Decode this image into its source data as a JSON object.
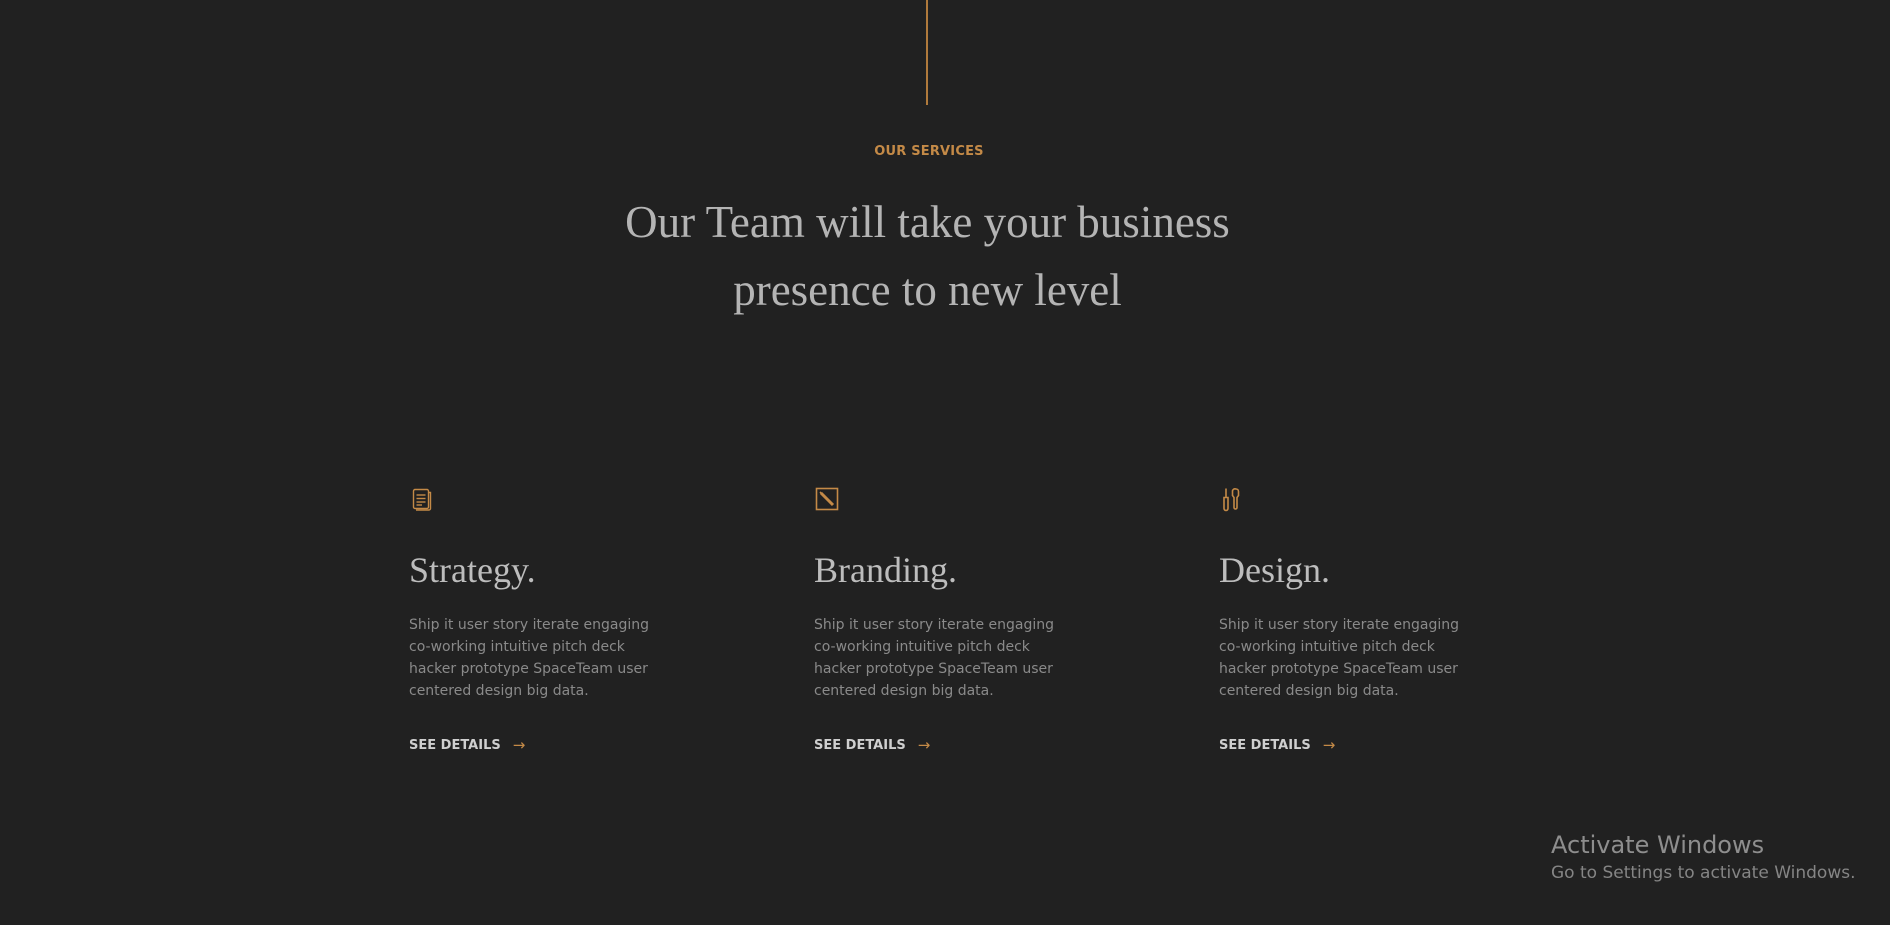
{
  "section": {
    "eyebrow": "OUR SERVICES",
    "title": "Our Team will take your business presence to new level"
  },
  "colors": {
    "background": "#212121",
    "accent": "#c48a47",
    "heading": "#b4b4b4",
    "body_text": "#8a8a8a"
  },
  "services": [
    {
      "icon": "document-icon",
      "title": "Strategy.",
      "description": "Ship it user story iterate engaging co-working intuitive pitch deck hacker prototype SpaceTeam user centered design big data.",
      "link_label": "SEE DETAILS",
      "link_arrow": "→"
    },
    {
      "icon": "edit-square-icon",
      "title": "Branding.",
      "description": "Ship it user story iterate engaging co-working intuitive pitch deck hacker prototype SpaceTeam user centered design big data.",
      "link_label": "SEE DETAILS",
      "link_arrow": "→"
    },
    {
      "icon": "tools-icon",
      "title": "Design.",
      "description": "Ship it user story iterate engaging co-working intuitive pitch deck hacker prototype SpaceTeam user centered design big data.",
      "link_label": "SEE DETAILS",
      "link_arrow": "→"
    }
  ],
  "windows_watermark": {
    "title": "Activate Windows",
    "subtitle": "Go to Settings to activate Windows."
  }
}
